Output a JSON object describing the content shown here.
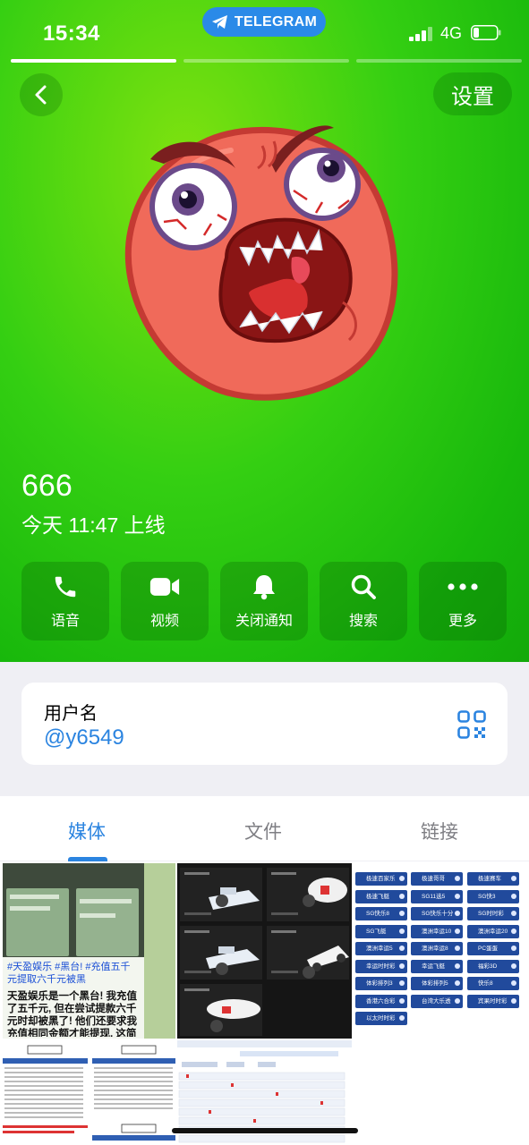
{
  "status_bar": {
    "time": "15:34",
    "pill_label": "TELEGRAM",
    "network": "4G"
  },
  "story_progress": {
    "segments": 3,
    "active_index": 0
  },
  "header": {
    "back_icon": "chevron-left-icon",
    "settings_label": "设置"
  },
  "profile": {
    "name": "666",
    "last_seen": "今天 11:47 上线"
  },
  "actions": [
    {
      "label": "语音",
      "icon": "phone-icon"
    },
    {
      "label": "视频",
      "icon": "video-camera-icon"
    },
    {
      "label": "关闭通知",
      "icon": "bell-icon"
    },
    {
      "label": "搜索",
      "icon": "search-icon"
    },
    {
      "label": "更多",
      "icon": "more-dots-icon"
    }
  ],
  "username_card": {
    "label": "用户名",
    "value": "@y6549",
    "icon": "qr-code-icon"
  },
  "tabs": [
    {
      "label": "媒体",
      "active": true
    },
    {
      "label": "文件",
      "active": false
    },
    {
      "label": "链接",
      "active": false
    }
  ],
  "media": {
    "post_text_blue": "#天盈娱乐 #黑台! #充值五千元提取六千元被黑",
    "post_text_black": "天盈娱乐是一个黑台! 我充值了五千元, 但在尝试提款六千元时却被黑了! 他们还要求我充值相同金额才能提现, 这简直把我当傻子了, 兄弟们千万别上当, 避免遇到这种诈骗行",
    "game_buttons": [
      "极速百家乐",
      "极速哥哥",
      "极速赛车",
      "极速飞艇",
      "SG11选5",
      "SG快3",
      "SG快乐8",
      "SG快乐十分",
      "SG时时彩",
      "SG飞艇",
      "澳洲幸运10",
      "澳洲幸运20",
      "澳洲幸运5",
      "澳洲幸运8",
      "PC蛋蛋",
      "幸运时时彩",
      "幸运飞艇",
      "福彩3D",
      "体彩排列3",
      "体彩排列5",
      "快乐8",
      "香港六合彩",
      "台湾大乐透",
      "宾果时时彩",
      "以太时时彩"
    ]
  },
  "colors": {
    "accent": "#2b84e0",
    "hero_green": "#34cf12",
    "pill_blue": "#2a8ae8"
  }
}
